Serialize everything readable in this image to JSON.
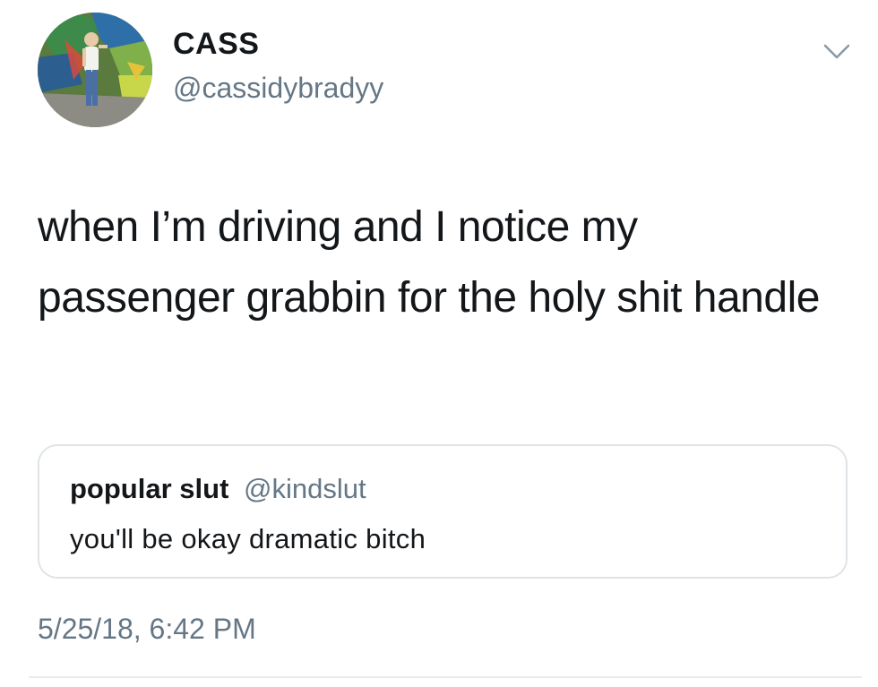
{
  "author": {
    "display_name": "CASS",
    "handle": "@cassidybradyy"
  },
  "tweet": {
    "text": "when I’m driving and I notice my passenger grabbin for the holy shit handle",
    "timestamp": "5/25/18, 6:42 PM"
  },
  "quoted_tweet": {
    "display_name": "popular slut",
    "handle": "@kindslut",
    "text": "you'll be okay dramatic bitch"
  },
  "icons": {
    "menu": "chevron-down-icon"
  },
  "colors": {
    "primary_text": "#14171a",
    "secondary_text": "#657786",
    "border": "#dfe4e8"
  }
}
